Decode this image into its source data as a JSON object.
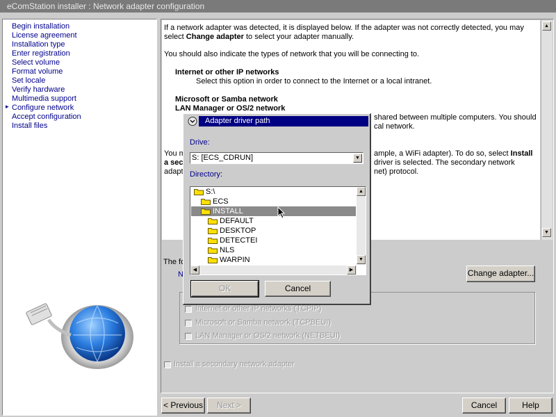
{
  "window": {
    "title": "eComStation installer : Network adapter configuration"
  },
  "nav": {
    "items": [
      {
        "label": "Begin installation"
      },
      {
        "label": "License agreement"
      },
      {
        "label": "Installation type"
      },
      {
        "label": "Enter registration"
      },
      {
        "label": "Select volume"
      },
      {
        "label": "Format volume"
      },
      {
        "label": "Set locale"
      },
      {
        "label": "Verify hardware"
      },
      {
        "label": "Multimedia support"
      },
      {
        "label": "Configure network",
        "current": true
      },
      {
        "label": "Accept configuration"
      },
      {
        "label": "Install files"
      }
    ],
    "current_marker": "▸"
  },
  "content": {
    "para1_line1": "If a network adapter was detected, it is displayed below.  If the adapter was not correctly detected, you may",
    "para1_line2_pre": "select ",
    "para1_line2_bold": "Change adapter",
    "para1_line2_post": " to select your adapter manually.",
    "para2": "You should also indicate the types of network that you will be connecting to.",
    "ip_heading": "Internet or other IP networks",
    "ip_desc": "Select this option in order to connect to the Internet or a local intranet.",
    "ms_heading": "Microsoft or Samba network",
    "lm_heading": "LAN Manager or OS/2 network",
    "shared_line1": "shared between multiple computers.  You should",
    "shared_line2": "cal network.",
    "you_frag": "You m",
    "a_sec_frag": "a sec",
    "adapt_frag": "adapt",
    "right_line1_pre": "ample, a WiFi adapter).  To do so, select ",
    "right_line1_bold": "Install",
    "right_line2": "driver is selected.  The secondary network",
    "right_line3": "net) protocol.",
    "the_fo_frag": "The fo",
    "n_frag": "N"
  },
  "buttons": {
    "change_adapter": "Change adapter...",
    "previous": "< Previous",
    "next": "Next >",
    "cancel": "Cancel",
    "help": "Help"
  },
  "protocols": {
    "items": [
      {
        "label": "Internet or other IP networks (TCPIP)",
        "checked": false
      },
      {
        "label": "Microsoft or Samba network (TCPBEUI)",
        "checked": false
      },
      {
        "label": "LAN Manager or OS/2 network (NETBEUI)",
        "checked": false
      }
    ],
    "secondary_label": "Install a secondary network  adapter"
  },
  "dialog": {
    "title": "Adapter driver path",
    "drive_label": "Drive:",
    "drive_value": "S:  [ECS_CDRUN]",
    "directory_label": "Directory:",
    "directories": [
      {
        "name": "S:\\",
        "depth": 0,
        "selected": false
      },
      {
        "name": "ECS",
        "depth": 1,
        "selected": false
      },
      {
        "name": "INSTALL",
        "depth": 1,
        "selected": true
      },
      {
        "name": "DEFAULT",
        "depth": 2,
        "selected": false
      },
      {
        "name": "DESKTOP",
        "depth": 2,
        "selected": false
      },
      {
        "name": "DETECTEI",
        "depth": 2,
        "selected": false
      },
      {
        "name": "NLS",
        "depth": 2,
        "selected": false
      },
      {
        "name": "WARPIN",
        "depth": 2,
        "selected": false
      }
    ],
    "ok_label": "OK",
    "cancel_label": "Cancel"
  },
  "colors": {
    "nav_link": "#00008b",
    "dialog_title_bg": "#000082",
    "selection": "#8a8a8a",
    "folder": "#ffe000"
  }
}
